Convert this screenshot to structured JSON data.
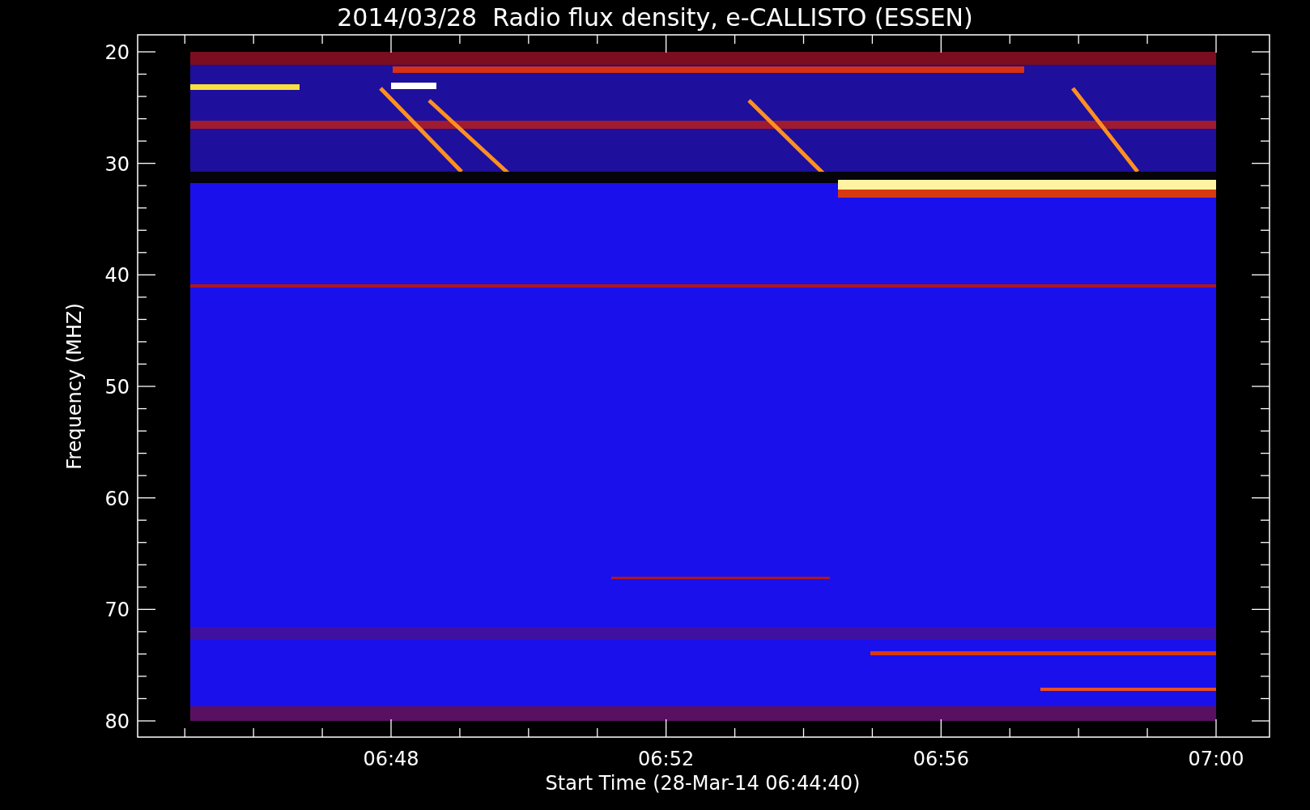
{
  "title": "2014/03/28  Radio flux density, e-CALLISTO (ESSEN)",
  "y_axis": {
    "label": "Frequency (MHZ)",
    "ticks": [
      "20",
      "30",
      "40",
      "50",
      "60",
      "70",
      "80"
    ]
  },
  "x_axis": {
    "label": "Start Time (28-Mar-14 06:44:40)",
    "ticks": [
      "06:48",
      "06:52",
      "06:56",
      "07:00"
    ]
  }
}
